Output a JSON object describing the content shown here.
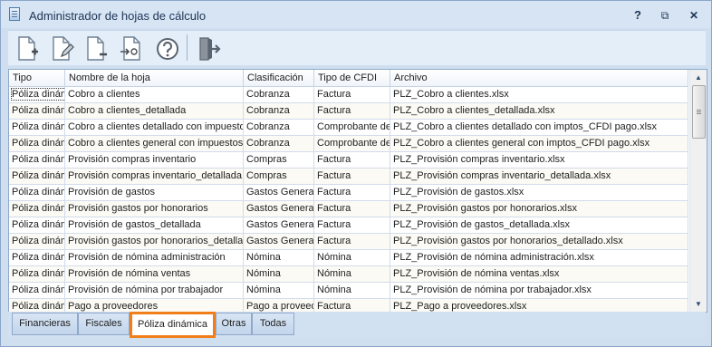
{
  "window": {
    "title": "Administrador de hojas de cálculo"
  },
  "window_controls": {
    "help": "?",
    "restore": "⧉",
    "maximize": "▣",
    "close": "✕"
  },
  "toolbar": {
    "buttons": [
      {
        "name": "new-sheet-button",
        "icon": "new-document-icon"
      },
      {
        "name": "edit-sheet-button",
        "icon": "edit-document-icon"
      },
      {
        "name": "delete-sheet-button",
        "icon": "remove-document-icon"
      },
      {
        "name": "export-sheet-button",
        "icon": "send-email-icon"
      },
      {
        "name": "help-button",
        "icon": "help-icon"
      },
      {
        "name": "exit-button",
        "icon": "exit-door-icon"
      }
    ]
  },
  "grid": {
    "columns": [
      "Tipo",
      "Nombre de la hoja",
      "Clasificación",
      "Tipo de CFDI",
      "Archivo"
    ],
    "rows": [
      [
        "Póliza dinám",
        "Cobro a clientes",
        "Cobranza",
        "Factura",
        "PLZ_Cobro a clientes.xlsx"
      ],
      [
        "Póliza dinám",
        "Cobro a clientes_detallada",
        "Cobranza",
        "Factura",
        "PLZ_Cobro a clientes_detallada.xlsx"
      ],
      [
        "Póliza dinám",
        "Cobro a clientes detallado con impuestos_CFDI pago",
        "Cobranza",
        "Comprobante de pago",
        "PLZ_Cobro a clientes detallado con imptos_CFDI pago.xlsx"
      ],
      [
        "Póliza dinám",
        "Cobro a clientes general con impuestos_CFDI pago",
        "Cobranza",
        "Comprobante de pago",
        "PLZ_Cobro a clientes general con imptos_CFDI pago.xlsx"
      ],
      [
        "Póliza dinám",
        "Provisión compras inventario",
        "Compras",
        "Factura",
        "PLZ_Provisión compras inventario.xlsx"
      ],
      [
        "Póliza dinám",
        "Provisión compras inventario_detallada",
        "Compras",
        "Factura",
        "PLZ_Provisión compras inventario_detallada.xlsx"
      ],
      [
        "Póliza dinám",
        "Provisión de gastos",
        "Gastos Generales",
        "Factura",
        "PLZ_Provisión de gastos.xlsx"
      ],
      [
        "Póliza dinám",
        "Provisión gastos por honorarios",
        "Gastos Generales",
        "Factura",
        "PLZ_Provisión gastos por honorarios.xlsx"
      ],
      [
        "Póliza dinám",
        "Provisión de gastos_detallada",
        "Gastos Generales",
        "Factura",
        "PLZ_Provisión de gastos_detallada.xlsx"
      ],
      [
        "Póliza dinám",
        "Provisión gastos por honorarios_detallado",
        "Gastos Generales",
        "Factura",
        "PLZ_Provisión gastos por honorarios_detallado.xlsx"
      ],
      [
        "Póliza dinám",
        "Provisión de nómina administración",
        "Nómina",
        "Nómina",
        "PLZ_Provisión de nómina administración.xlsx"
      ],
      [
        "Póliza dinám",
        "Provisión de nómina ventas",
        "Nómina",
        "Nómina",
        "PLZ_Provisión de nómina ventas.xlsx"
      ],
      [
        "Póliza dinám",
        "Provisión de nómina por trabajador",
        "Nómina",
        "Nómina",
        "PLZ_Provisión de nómina por trabajador.xlsx"
      ],
      [
        "Póliza dinám",
        "Pago a proveedores",
        "Pago a proveedores",
        "Factura",
        "PLZ_Pago a proveedores.xlsx"
      ]
    ]
  },
  "tabs": [
    {
      "label": "Financieras"
    },
    {
      "label": "Fiscales"
    },
    {
      "label": "Póliza dinámica",
      "active": true
    },
    {
      "label": "Otras"
    },
    {
      "label": "Todas"
    }
  ],
  "colors": {
    "highlight": "#f07e1b",
    "window_bg": "#cfdff0",
    "row_alt": "#fbfaf4"
  }
}
